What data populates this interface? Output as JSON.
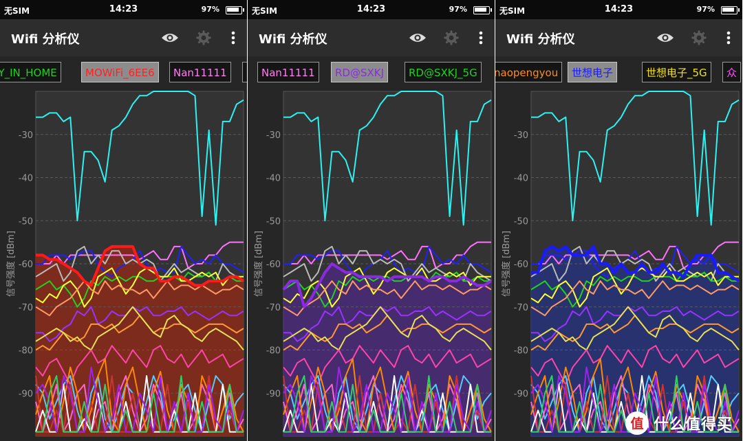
{
  "status_bar": {
    "carrier": "无SIM",
    "time": "14:23",
    "battery": "97%"
  },
  "app": {
    "title": "Wifi 分析仪",
    "icons": [
      "eye-icon",
      "gear-icon",
      "more-vert-icon"
    ]
  },
  "colors": {
    "background": "#262626",
    "plot_bg": "#333333",
    "grid": "#5a5a5a",
    "axis_text": "#9a9a9a"
  },
  "screens": [
    {
      "chips": [
        {
          "label": "RY_IN_HOME",
          "color": "#22d022",
          "selected": false
        },
        {
          "label": "MOWiFi_6EE6",
          "color": "#ff2222",
          "selected": true
        },
        {
          "label": "Nan11111",
          "color": "#ff7ef0",
          "selected": false
        },
        {
          "label": "",
          "color": "#cccccc",
          "selected": false
        }
      ],
      "highlight": {
        "color": "#ff1a1a",
        "fill": "#8a2a1a"
      }
    },
    {
      "chips": [
        {
          "label": "Nan11111",
          "color": "#ff7ef0",
          "selected": false
        },
        {
          "label": "RD@SXKJ",
          "color": "#8a2be2",
          "selected": true
        },
        {
          "label": "RD@SXKJ_5G",
          "color": "#22d022",
          "selected": false
        }
      ],
      "highlight": {
        "color": "#8a2be2",
        "fill": "#4a2a7a"
      }
    },
    {
      "chips": [
        {
          "label": "naopengyou",
          "color": "#ff8c1a",
          "selected": false
        },
        {
          "label": "世想电子",
          "color": "#1a1aff",
          "selected": true
        },
        {
          "label": "世想电子_5G",
          "color": "#f0e020",
          "selected": false
        },
        {
          "label": "众",
          "color": "#ff50ff",
          "selected": false
        }
      ],
      "highlight": {
        "color": "#1a1aff",
        "fill": "#26327a"
      }
    }
  ],
  "chart_data": {
    "type": "line",
    "ylabel": "信号强度 [dBm]",
    "yticks": [
      -30,
      -40,
      -50,
      -60,
      -70,
      -80,
      -90
    ],
    "ylim": [
      -100,
      -20
    ],
    "grid": true,
    "series": [
      {
        "color": "#2ef2f2",
        "values": [
          -26,
          -26,
          -25,
          -25,
          -27,
          -26,
          -50,
          -34,
          -34,
          -36,
          -41,
          -29,
          -28,
          -26,
          -23,
          -21,
          -21,
          -20,
          -20,
          -20,
          -20,
          -20,
          -20,
          -21,
          -49,
          -29,
          -51,
          -27,
          -27,
          -23,
          -22
        ]
      },
      {
        "color": "#ff70ff",
        "values": [
          -60,
          -60,
          -60,
          -58,
          -60,
          -58,
          -58,
          -58,
          -58,
          -58,
          -58,
          -58,
          -58,
          -58,
          -58,
          -59,
          -58,
          -57,
          -59,
          -59,
          -56,
          -56,
          -61,
          -60,
          -60,
          -58,
          -58,
          -56,
          -55,
          -55,
          -55
        ]
      },
      {
        "color": "#2020ff",
        "values": [
          -60,
          -60,
          -58,
          -58,
          -58,
          -59,
          -58,
          -57,
          -57,
          -60,
          -62,
          -63,
          -61,
          -60,
          -59,
          -57,
          -60,
          -62,
          -61,
          -62,
          -62,
          -56,
          -58,
          -60,
          -59,
          -60,
          -58,
          -60,
          -60,
          -61,
          -62
        ]
      },
      {
        "color": "#bbbbbb",
        "values": [
          -63,
          -62,
          -61,
          -60,
          -64,
          -62,
          -57,
          -56,
          -60,
          -58,
          -60,
          -57,
          -57,
          -60,
          -59,
          -60,
          -59,
          -60,
          -64,
          -62,
          -60,
          -62,
          -61,
          -62,
          -63,
          -62,
          -64,
          -60,
          -62,
          -63,
          -64
        ]
      },
      {
        "color": "#22d022",
        "values": [
          -66,
          -65,
          -64,
          -66,
          -65,
          -67,
          -70,
          -68,
          -64,
          -65,
          -63,
          -64,
          -63,
          -64,
          -63,
          -63,
          -64,
          -64,
          -63,
          -63,
          -63,
          -64,
          -62,
          -63,
          -63,
          -62,
          -64,
          -64,
          -63,
          -64,
          -64
        ]
      },
      {
        "color": "#ffff33",
        "values": [
          -68,
          -69,
          -67,
          -68,
          -65,
          -64,
          -66,
          -70,
          -68,
          -63,
          -62,
          -61,
          -64,
          -67,
          -65,
          -62,
          -61,
          -62,
          -63,
          -63,
          -61,
          -64,
          -64,
          -63,
          -62,
          -63,
          -62,
          -65,
          -63,
          -63,
          -63
        ]
      },
      {
        "color": "#ff9966",
        "values": [
          -70,
          -71,
          -72,
          -70,
          -69,
          -68,
          -66,
          -64,
          -66,
          -67,
          -64,
          -66,
          -65,
          -66,
          -66,
          -67,
          -66,
          -68,
          -66,
          -64,
          -66,
          -65,
          -65,
          -66,
          -65,
          -66,
          -67,
          -66,
          -66,
          -65,
          -66
        ]
      },
      {
        "color": "#9933ff",
        "values": [
          -76,
          -76,
          -78,
          -77,
          -75,
          -74,
          -71,
          -72,
          -70,
          -74,
          -73,
          -71,
          -72,
          -72,
          -70,
          -71,
          -70,
          -72,
          -72,
          -71,
          -71,
          -70,
          -72,
          -71,
          -72,
          -73,
          -72,
          -71,
          -72,
          -72,
          -71
        ]
      },
      {
        "color": "#ff9933",
        "values": [
          -80,
          -79,
          -80,
          -78,
          -76,
          -77,
          -78,
          -77,
          -74,
          -74,
          -75,
          -74,
          -76,
          -75,
          -74,
          -72,
          -74,
          -76,
          -75,
          -75,
          -74,
          -74,
          -75,
          -76,
          -75,
          -74,
          -74,
          -74,
          -75,
          -76,
          -75
        ]
      },
      {
        "color": "#e8e055",
        "values": [
          -78,
          -77,
          -76,
          -75,
          -76,
          -78,
          -77,
          -79,
          -80,
          -77,
          -76,
          -75,
          -74,
          -72,
          -70,
          -72,
          -74,
          -76,
          -77,
          -73,
          -72,
          -74,
          -75,
          -77,
          -78,
          -76,
          -75,
          -76,
          -77,
          -78,
          -80
        ]
      },
      {
        "color": "#ff44aa",
        "values": [
          -84,
          -86,
          -83,
          -82,
          -85,
          -88,
          -84,
          -82,
          -80,
          -83,
          -82,
          -79,
          -81,
          -83,
          -80,
          -82,
          -84,
          -80,
          -79,
          -82,
          -83,
          -81,
          -84,
          -82,
          -80,
          -83,
          -82,
          -81,
          -84,
          -83,
          -82
        ]
      },
      {
        "color": "#55ccff",
        "values": [
          -88,
          -90,
          -96,
          -92,
          -88,
          -86,
          -94,
          -99,
          -90,
          -86,
          -96,
          -99,
          -94,
          -88,
          -90,
          -98,
          -92,
          -86,
          -90,
          -99,
          -96,
          -90,
          -88,
          -94,
          -99,
          -92,
          -86,
          -88,
          -96,
          -92,
          -90
        ]
      },
      {
        "color": "#ff66cc",
        "values": [
          -92,
          -99,
          -94,
          -88,
          -99,
          -96,
          -90,
          -88,
          -99,
          -94,
          -92,
          -99,
          -90,
          -86,
          -94,
          -99,
          -96,
          -88,
          -92,
          -99,
          -94,
          -90,
          -99,
          -96,
          -88,
          -92,
          -99,
          -94,
          -90,
          -99,
          -96
        ]
      },
      {
        "color": "#ff8800",
        "values": [
          -95,
          -90,
          -86,
          -99,
          -92,
          -84,
          -90,
          -99,
          -94,
          -86,
          -82,
          -96,
          -99,
          -88,
          -84,
          -92,
          -99,
          -90,
          -85,
          -94,
          -99,
          -88,
          -92,
          -99,
          -86,
          -90,
          -99,
          -94,
          -88,
          -96,
          -99
        ]
      },
      {
        "color": "#cc3333",
        "values": [
          -86,
          -99,
          -99,
          -94,
          -99,
          -88,
          -99,
          -99,
          -92,
          -99,
          -99,
          -86,
          -99,
          -99,
          -90,
          -99,
          -99,
          -96,
          -99,
          -88,
          -99,
          -99,
          -92,
          -99,
          -99,
          -86,
          -99,
          -99,
          -94,
          -99,
          -99
        ]
      },
      {
        "color": "#ffffff",
        "values": [
          -99,
          -94,
          -99,
          -99,
          -88,
          -99,
          -99,
          -96,
          -99,
          -90,
          -99,
          -99,
          -99,
          -92,
          -99,
          -99,
          -86,
          -99,
          -99,
          -99,
          -94,
          -99,
          -99,
          -90,
          -99,
          -99,
          -99,
          -88,
          -99,
          -99,
          -99
        ]
      },
      {
        "color": "#a020f0",
        "values": [
          -90,
          -88,
          -92,
          -99,
          -86,
          -90,
          -99,
          -99,
          -84,
          -92,
          -99,
          -96,
          -88,
          -99,
          -99,
          -90,
          -94,
          -99,
          -86,
          -99,
          -92,
          -99,
          -90,
          -99,
          -99,
          -88,
          -96,
          -99,
          -92,
          -99,
          -94
        ]
      },
      {
        "color": "#33cc66",
        "values": [
          -99,
          -99,
          -90,
          -86,
          -99,
          -99,
          -99,
          -92,
          -99,
          -99,
          -88,
          -99,
          -99,
          -94,
          -99,
          -99,
          -99,
          -90,
          -99,
          -99,
          -99,
          -86,
          -99,
          -99,
          -92,
          -99,
          -99,
          -99,
          -88,
          -99,
          -99
        ]
      }
    ],
    "highlighted": [
      {
        "screen": 0,
        "label": "MOWiFi_6EE6",
        "color": "#ff1a1a",
        "values": [
          -58,
          -58,
          -59,
          -59,
          -60,
          -61,
          -62,
          -64,
          -65,
          -61,
          -57,
          -56,
          -56,
          -56,
          -56,
          -60,
          -61,
          -61,
          -64,
          -64,
          -63,
          -63,
          -64,
          -65,
          -65,
          -64,
          -64,
          -64,
          -63,
          -63,
          -64
        ]
      },
      {
        "screen": 1,
        "label": "RD@SXKJ",
        "color": "#8a2be2",
        "values": [
          -66,
          -64,
          -64,
          -70,
          -68,
          -65,
          -62,
          -60,
          -61,
          -62,
          -62,
          -63,
          -63,
          -63,
          -63,
          -64,
          -63,
          -63,
          -63,
          -63,
          -63,
          -64,
          -63,
          -63,
          -64,
          -64,
          -63,
          -64,
          -65,
          -65,
          -64
        ]
      },
      {
        "screen": 2,
        "label": "世想电子",
        "color": "#1a1aff",
        "values": [
          -62,
          -62,
          -57,
          -56,
          -57,
          -56,
          -58,
          -58,
          -58,
          -56,
          -60,
          -60,
          -62,
          -60,
          -62,
          -62,
          -60,
          -62,
          -62,
          -60,
          -62,
          -62,
          -63,
          -60,
          -58,
          -58,
          -58,
          -62,
          -62,
          -63,
          -64
        ]
      }
    ]
  },
  "watermark": {
    "text": "什么值得买",
    "logo": "值"
  }
}
